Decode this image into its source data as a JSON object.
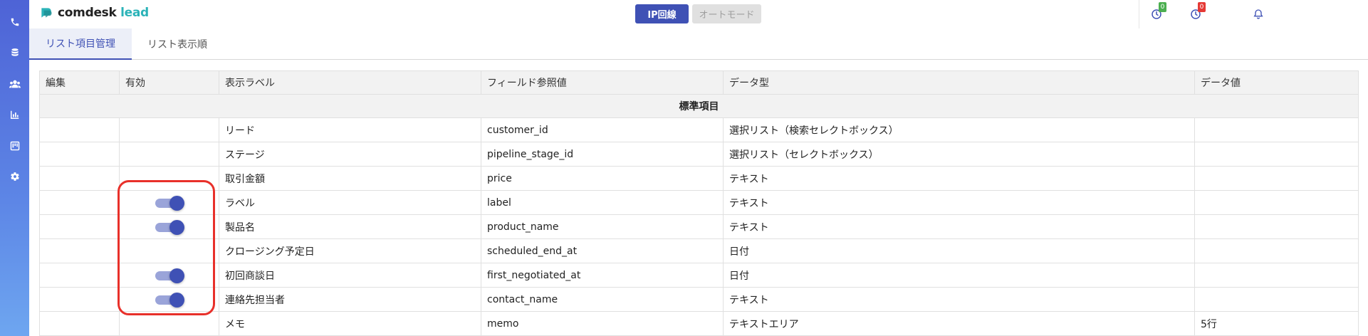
{
  "app": {
    "logo_main": "comdesk",
    "logo_accent": "lead"
  },
  "header": {
    "mode_ip": "IP回線",
    "mode_auto": "オートモード",
    "badge_1": "0",
    "badge_2": "0",
    "badge_1_color": "#4caf50",
    "badge_2_color": "#e53935"
  },
  "tabs": [
    {
      "label": "リスト項目管理"
    },
    {
      "label": "リスト表示順"
    }
  ],
  "table": {
    "columns": [
      "編集",
      "有効",
      "表示ラベル",
      "フィールド参照値",
      "データ型",
      "データ値"
    ],
    "section": "標準項目",
    "rows": [
      {
        "label": "リード",
        "field": "customer_id",
        "type": "選択リスト（検索セレクトボックス）",
        "value": "",
        "toggle": false
      },
      {
        "label": "ステージ",
        "field": "pipeline_stage_id",
        "type": "選択リスト（セレクトボックス）",
        "value": "",
        "toggle": false
      },
      {
        "label": "取引金額",
        "field": "price",
        "type": "テキスト",
        "value": "",
        "toggle": false
      },
      {
        "label": "ラベル",
        "field": "label",
        "type": "テキスト",
        "value": "",
        "toggle": true
      },
      {
        "label": "製品名",
        "field": "product_name",
        "type": "テキスト",
        "value": "",
        "toggle": true
      },
      {
        "label": "クロージング予定日",
        "field": "scheduled_end_at",
        "type": "日付",
        "value": "",
        "toggle": false
      },
      {
        "label": "初回商談日",
        "field": "first_negotiated_at",
        "type": "日付",
        "value": "",
        "toggle": true
      },
      {
        "label": "連絡先担当者",
        "field": "contact_name",
        "type": "テキスト",
        "value": "",
        "toggle": true
      },
      {
        "label": "メモ",
        "field": "memo",
        "type": "テキストエリア",
        "value": "5行",
        "toggle": false
      }
    ]
  },
  "colors": {
    "primary": "#3f51b5",
    "highlight": "#e8302a",
    "accent": "#2bb3b8"
  },
  "sidebar": {
    "icons": [
      "phone-icon",
      "database-icon",
      "users-icon",
      "bar-chart-icon",
      "kanban-icon",
      "gear-icon"
    ]
  }
}
